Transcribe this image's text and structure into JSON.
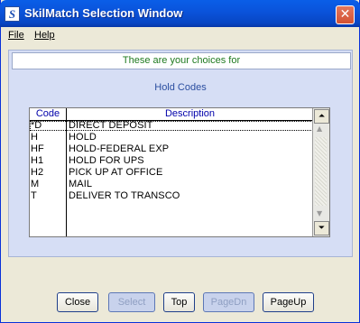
{
  "window": {
    "title": "SkilMatch Selection Window",
    "icon": "S",
    "close_glyph": "✕"
  },
  "menu": {
    "items": [
      {
        "label": "File"
      },
      {
        "label": "Help"
      }
    ]
  },
  "panel": {
    "caption": "These are your choices for",
    "subtitle": "Hold Codes"
  },
  "grid": {
    "columns": {
      "code": "Code",
      "description": "Description"
    },
    "rows": [
      {
        "code": "*D",
        "description": "DIRECT DEPOSIT"
      },
      {
        "code": "H",
        "description": "HOLD"
      },
      {
        "code": "HF",
        "description": "HOLD-FEDERAL EXP"
      },
      {
        "code": "H1",
        "description": "HOLD FOR UPS"
      },
      {
        "code": "H2",
        "description": "PICK UP AT OFFICE"
      },
      {
        "code": "M",
        "description": "MAIL"
      },
      {
        "code": "T",
        "description": "DELIVER TO TRANSCO"
      }
    ],
    "scroll": {
      "top_glyph": "⏶",
      "bottom_glyph": "⏷",
      "up_glyph": "▲",
      "down_glyph": "▼"
    }
  },
  "buttons": {
    "close": "Close",
    "select": "Select",
    "top": "Top",
    "pagedn": "PageDn",
    "pageup": "PageUp"
  }
}
